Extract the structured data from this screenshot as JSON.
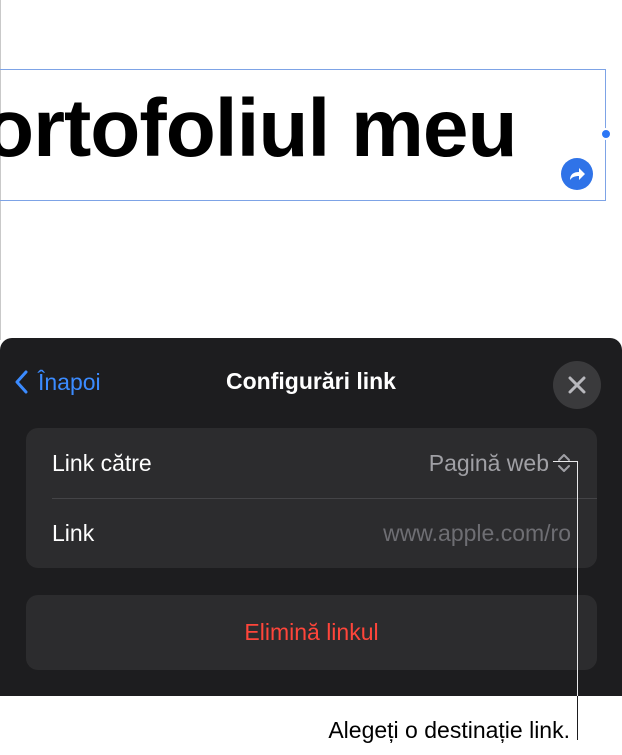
{
  "document": {
    "textbox_text": "ortofoliul meu"
  },
  "panel": {
    "back_label": "Înapoi",
    "title": "Configurări link",
    "link_to_label": "Link către",
    "link_to_value": "Pagină web",
    "link_label": "Link",
    "link_placeholder": "www.apple.com/ro",
    "link_value": "",
    "remove_label": "Elimină linkul"
  },
  "callout": {
    "text": "Alegeți o destinație link."
  },
  "colors": {
    "accent": "#3b8bff",
    "destructive": "#ff453a",
    "panel_bg": "#1d1d1f",
    "group_bg": "#2c2c2e",
    "selection": "#7da3e6"
  },
  "icons": {
    "back": "chevron-left-icon",
    "close": "close-icon",
    "select": "chevron-up-down-icon",
    "link_badge": "curved-arrow-icon"
  }
}
